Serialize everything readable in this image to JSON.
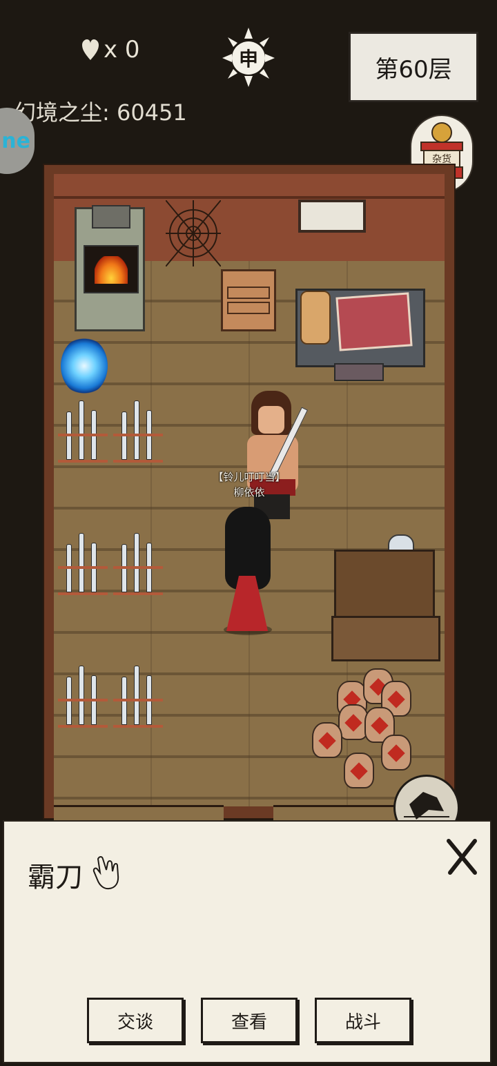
{
  "hud": {
    "lives_label": "x 0",
    "time_symbol": "申",
    "floor_label": "第60层",
    "dust_label": "幻境之尘: 60451",
    "side_tab_text": "ne"
  },
  "scene": {
    "npc_title": "【铃儿叮叮当】",
    "npc_name": "柳依依"
  },
  "dialog": {
    "npc_name": "霸刀",
    "close_label": "X",
    "buttons": [
      {
        "label": "交谈"
      },
      {
        "label": "查看"
      },
      {
        "label": "战斗"
      }
    ]
  },
  "colors": {
    "background": "#1d1812",
    "floor_wood": "#8a7048",
    "wall": "#8c4a32",
    "dialog_paper": "#f3efe3"
  },
  "icons": [
    "heart-icon",
    "sun-clock-icon",
    "shop-icon",
    "portal-icon",
    "hand-pointer-icon",
    "close-icon",
    "menu-icon"
  ]
}
